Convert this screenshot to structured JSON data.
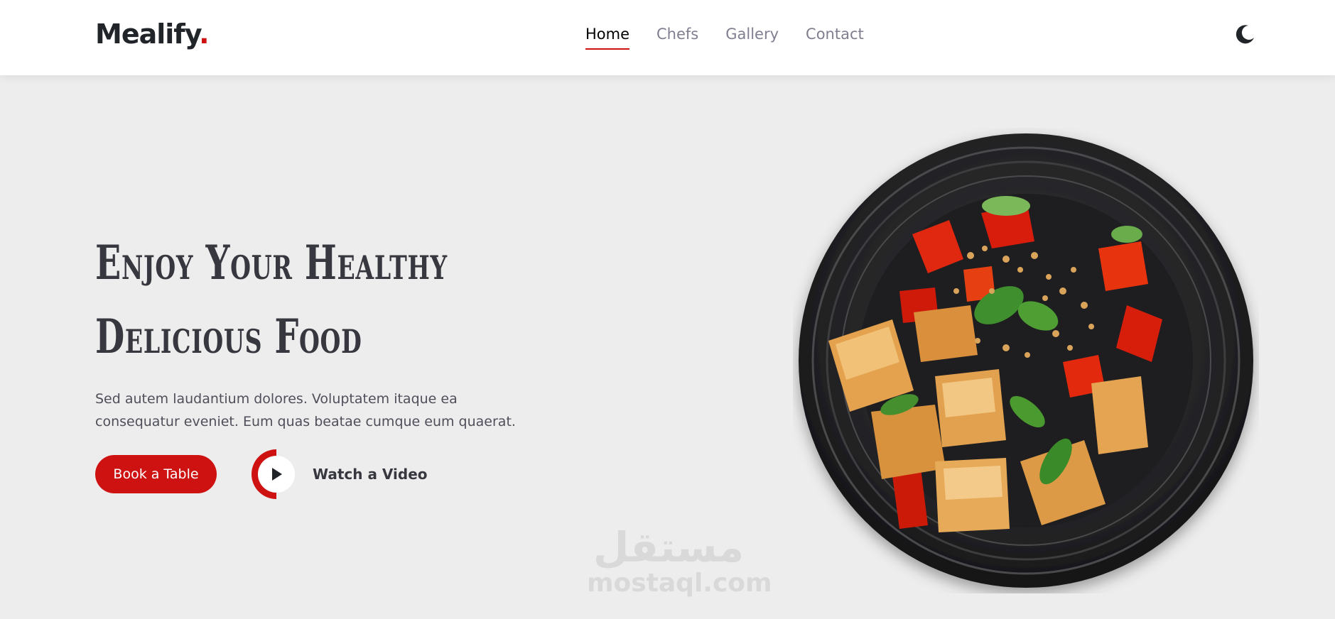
{
  "header": {
    "logo_text": "Mealify",
    "logo_dot": ".",
    "nav": [
      {
        "label": "Home",
        "active": true
      },
      {
        "label": "Chefs",
        "active": false
      },
      {
        "label": "Gallery",
        "active": false
      },
      {
        "label": "Contact",
        "active": false
      }
    ],
    "theme_icon": "moon-icon"
  },
  "hero": {
    "title_line1": "Enjoy Your Healthy",
    "title_line2": "Delicious Food",
    "description": "Sed autem laudantium dolores. Voluptatem itaque ea consequatur eveniet. Eum quas beatae cumque eum quaerat.",
    "book_button": "Book a Table",
    "watch_label": "Watch a Video",
    "play_icon": "play-icon",
    "image": "food-plate-image"
  },
  "watermark": {
    "arabic": "مستقل",
    "latin": "mostaql.com"
  },
  "colors": {
    "accent": "#ce1212",
    "background": "#ededed",
    "header_bg": "#ffffff",
    "nav_inactive": "#7f7f90",
    "heading": "#37373f"
  }
}
